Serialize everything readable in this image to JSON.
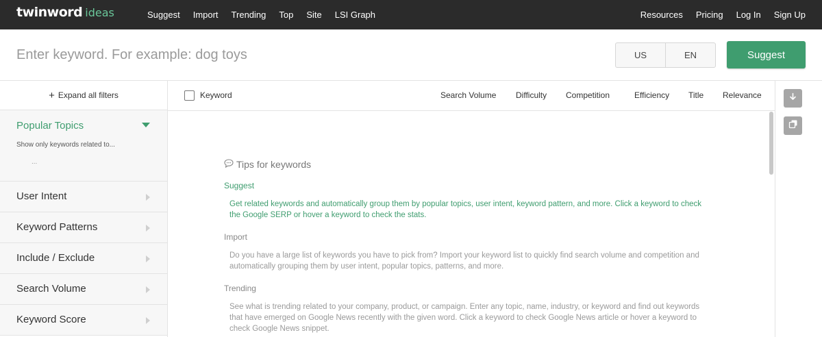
{
  "brand": {
    "main": "twinword",
    "sub": "ideas"
  },
  "nav": {
    "left": [
      "Suggest",
      "Import",
      "Trending",
      "Top",
      "Site",
      "LSI Graph"
    ],
    "right": [
      "Resources",
      "Pricing",
      "Log In",
      "Sign Up"
    ]
  },
  "search": {
    "placeholder": "Enter keyword. For example: dog toys",
    "value": "",
    "country": "US",
    "language": "EN",
    "submit_label": "Suggest"
  },
  "sidebar": {
    "expand_label": "Expand all filters",
    "topics": {
      "title": "Popular Topics",
      "description": "Show only keywords related to...",
      "placeholder": "..."
    },
    "filters": [
      "User Intent",
      "Keyword Patterns",
      "Include / Exclude",
      "Search Volume",
      "Keyword Score"
    ]
  },
  "table": {
    "keyword_header": "Keyword",
    "columns": [
      "Search Volume",
      "Difficulty",
      "Competition",
      "Efficiency",
      "Title",
      "Relevance"
    ]
  },
  "tips": {
    "title": "Tips for keywords",
    "sections": [
      {
        "title": "Suggest",
        "text": "Get related keywords and automatically group them by popular topics, user intent, keyword pattern, and more. Click a keyword to check the Google SERP or hover a keyword to check the stats."
      },
      {
        "title": "Import",
        "text": "Do you have a large list of keywords you have to pick from? Import your keyword list to quickly find search volume and competition and automatically grouping them by user intent, popular topics, patterns, and more."
      },
      {
        "title": "Trending",
        "text": "See what is trending related to your company, product, or campaign. Enter any topic, name, industry, or keyword and find out keywords that have emerged on Google News recently with the given word. Click a keyword to check Google News article or hover a keyword to check Google News snippet."
      }
    ]
  },
  "colors": {
    "accent": "#3f9d6f",
    "nav_bg": "#2b2b2b",
    "panel_bg": "#f7f7f7"
  },
  "icons": {
    "download": "download-icon",
    "copy": "copy-icon",
    "tips": "speech-bubble-icon",
    "expand": "plus-icon"
  }
}
